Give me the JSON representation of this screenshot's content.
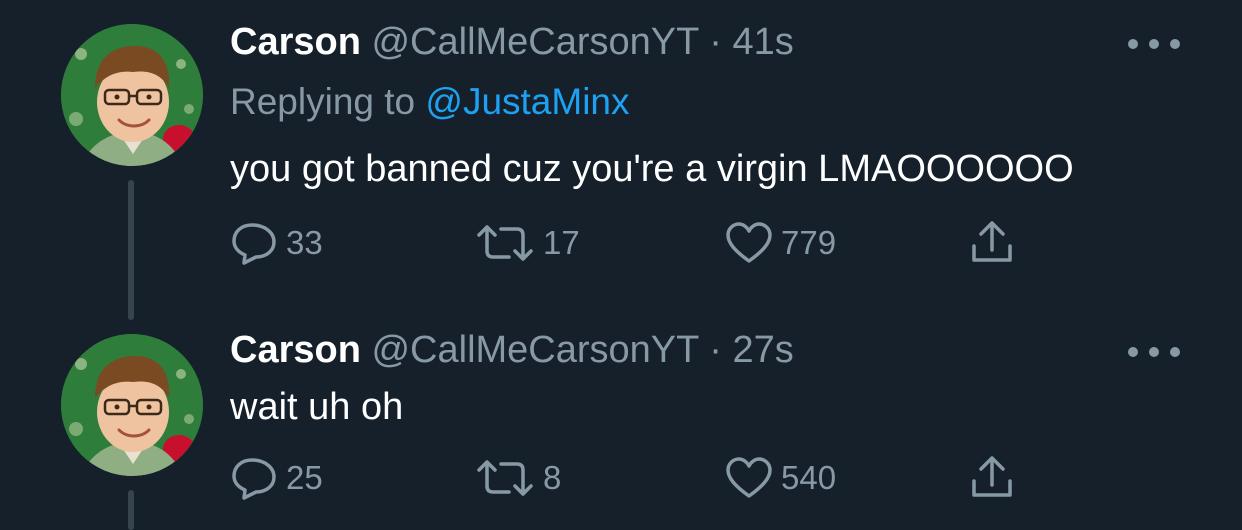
{
  "tweets": [
    {
      "name": "Carson",
      "handle": "@CallMeCarsonYT",
      "separator": "·",
      "time": "41s",
      "replying_prefix": "Replying to ",
      "replying_to": "@JustaMinx",
      "text": "you got banned cuz you're a virgin LMAOOOOOO",
      "stats": {
        "replies": "33",
        "retweets": "17",
        "likes": "779"
      }
    },
    {
      "name": "Carson",
      "handle": "@CallMeCarsonYT",
      "separator": "·",
      "time": "27s",
      "text": "wait uh oh",
      "stats": {
        "replies": "25",
        "retweets": "8",
        "likes": "540"
      }
    }
  ],
  "colors": {
    "background": "#15202b",
    "secondary_text": "#8899a6",
    "link": "#1da1f2",
    "primary_text": "#ffffff"
  },
  "icons": [
    "reply-icon",
    "retweet-icon",
    "like-icon",
    "share-icon",
    "more-icon"
  ]
}
